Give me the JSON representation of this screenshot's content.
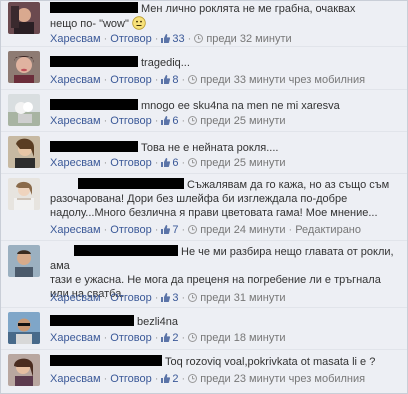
{
  "comments": [
    {
      "text_line1": "Мен лично роклята не ме грабна, очаквах",
      "text_line2": "нещо по- \"wow\"",
      "like_label": "Харесвам",
      "reply_label": "Отговор",
      "likes": "33",
      "time": "преди 32 минути",
      "suffix": ""
    },
    {
      "text": "tragediq...",
      "like_label": "Харесвам",
      "reply_label": "Отговор",
      "likes": "8",
      "time": "преди 33 минути чрез мобилния",
      "suffix": ""
    },
    {
      "text": "mnogo ee sku4na na men ne mi xaresva",
      "like_label": "Харесвам",
      "reply_label": "Отговор",
      "likes": "6",
      "time": "преди 25 минути",
      "suffix": ""
    },
    {
      "text": "Това не е нейната рокля....",
      "like_label": "Харесвам",
      "reply_label": "Отговор",
      "likes": "6",
      "time": "преди 25 минути",
      "suffix": ""
    },
    {
      "text_line1": "Съжалявам да го кажа, но аз също съм",
      "text_line2": "разочарована! Дори без шлейфа би изглеждала по-добре",
      "text_line3": "надолу...Много безлична я прави цветовата гама! Мое мнение...",
      "like_label": "Харесвам",
      "reply_label": "Отговор",
      "likes": "7",
      "time": "преди 24 минути",
      "suffix": "Редактирано"
    },
    {
      "text_line1": "Не че ми разбира нещо главата от рокли, ама",
      "text_line2": "тази е ужасна. Не мога да преценя на погребение ли е тръгнала",
      "text_line3": "или на сватба.",
      "like_label": "Харесвам",
      "reply_label": "Отговор",
      "likes": "3",
      "time": "преди 31 минути",
      "suffix": ""
    },
    {
      "text": "bezli4na",
      "like_label": "Харесвам",
      "reply_label": "Отговор",
      "likes": "2",
      "time": "преди 18 минути",
      "suffix": ""
    },
    {
      "text": "Toq rozoviq voal,pokrivkata ot masata li e ?",
      "like_label": "Харесвам",
      "reply_label": "Отговор",
      "likes": "2",
      "time": "преди 23 минути чрез мобилния",
      "suffix": ""
    }
  ],
  "colors": {
    "link": "#3b5998",
    "meta": "#777777",
    "background": "#edeff4"
  },
  "icons": {
    "emoji": "smiley-icon",
    "like": "thumbs-up-icon",
    "time": "clock-icon"
  }
}
